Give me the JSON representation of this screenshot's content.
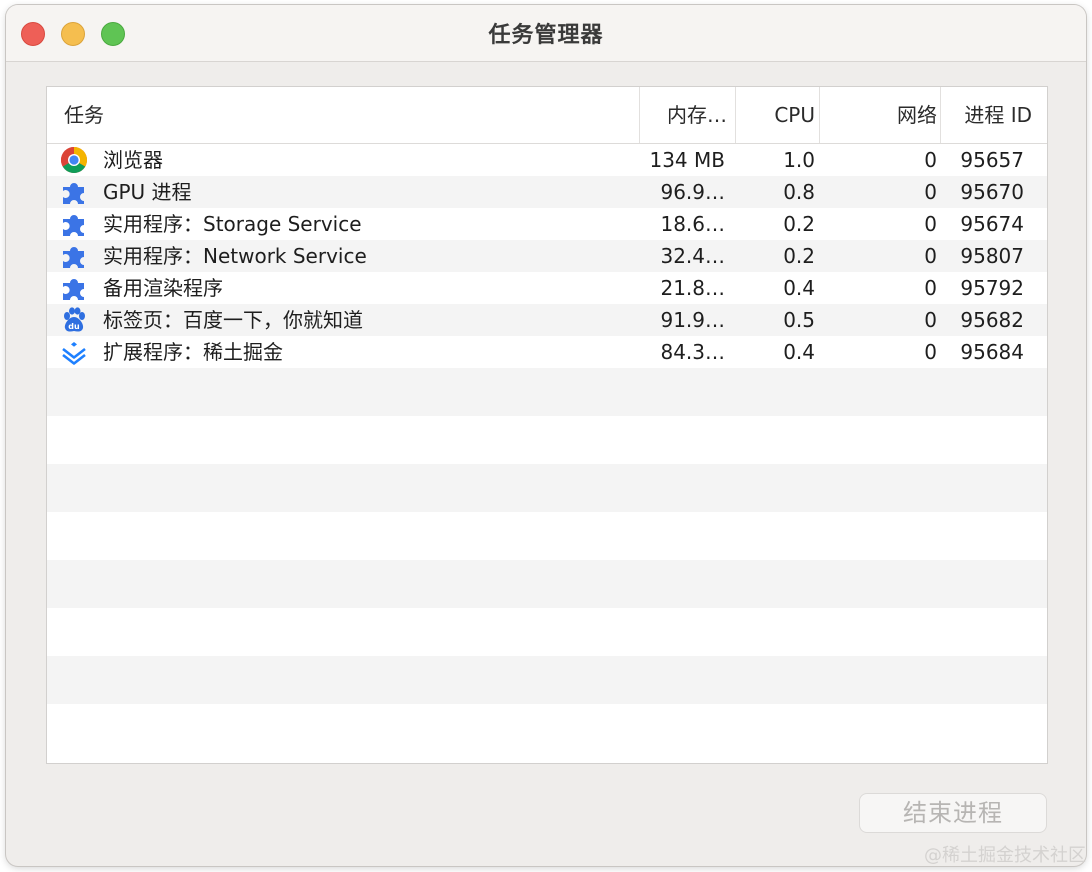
{
  "window": {
    "title": "任务管理器"
  },
  "table": {
    "headers": {
      "task": "任务",
      "memory": "内存…",
      "cpu": "CPU",
      "network": "网络",
      "pid": "进程 ID"
    },
    "rows": [
      {
        "icon": "chrome-icon",
        "name": "浏览器",
        "memory": "134 MB",
        "cpu": "1.0",
        "network": "0",
        "pid": "95657"
      },
      {
        "icon": "puzzle-icon",
        "name": "GPU 进程",
        "memory": "96.9…",
        "cpu": "0.8",
        "network": "0",
        "pid": "95670"
      },
      {
        "icon": "puzzle-icon",
        "name": "实用程序：Storage Service",
        "memory": "18.6…",
        "cpu": "0.2",
        "network": "0",
        "pid": "95674"
      },
      {
        "icon": "puzzle-icon",
        "name": "实用程序：Network Service",
        "memory": "32.4…",
        "cpu": "0.2",
        "network": "0",
        "pid": "95807"
      },
      {
        "icon": "puzzle-icon",
        "name": "备用渲染程序",
        "memory": "21.8…",
        "cpu": "0.4",
        "network": "0",
        "pid": "95792"
      },
      {
        "icon": "baidu-paw-icon",
        "name": "标签页：百度一下，你就知道",
        "memory": "91.9…",
        "cpu": "0.5",
        "network": "0",
        "pid": "95682"
      },
      {
        "icon": "juejin-icon",
        "name": "扩展程序：稀土掘金",
        "memory": "84.3…",
        "cpu": "0.4",
        "network": "0",
        "pid": "95684"
      }
    ]
  },
  "actions": {
    "end_process_label": "结束进程"
  },
  "watermark": "@稀土掘金技术社区",
  "colors": {
    "puzzle_blue": "#3b74e6",
    "window_bg": "#efedeb",
    "close": "#ee5f57",
    "minimize": "#f5be4f",
    "maximize": "#5fc454"
  }
}
